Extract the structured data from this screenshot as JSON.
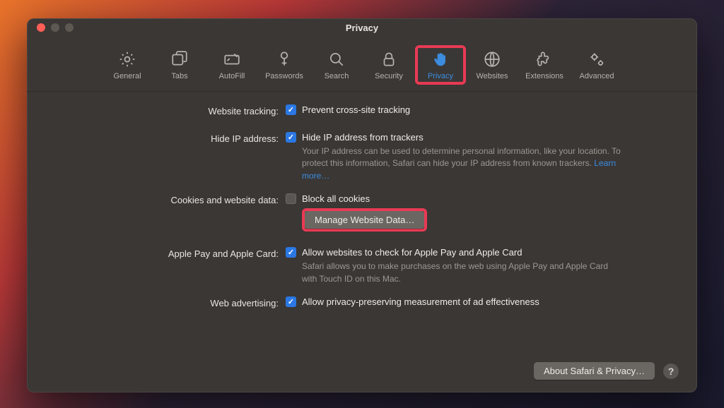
{
  "window": {
    "title": "Privacy"
  },
  "toolbar": {
    "items": [
      {
        "id": "general",
        "label": "General"
      },
      {
        "id": "tabs",
        "label": "Tabs"
      },
      {
        "id": "autofill",
        "label": "AutoFill"
      },
      {
        "id": "passwords",
        "label": "Passwords"
      },
      {
        "id": "search",
        "label": "Search"
      },
      {
        "id": "security",
        "label": "Security"
      },
      {
        "id": "privacy",
        "label": "Privacy",
        "active": true
      },
      {
        "id": "websites",
        "label": "Websites"
      },
      {
        "id": "extensions",
        "label": "Extensions"
      },
      {
        "id": "advanced",
        "label": "Advanced"
      }
    ]
  },
  "sections": {
    "website_tracking": {
      "label": "Website tracking:",
      "checkbox_label": "Prevent cross-site tracking",
      "checked": true
    },
    "hide_ip": {
      "label": "Hide IP address:",
      "checkbox_label": "Hide IP address from trackers",
      "checked": true,
      "desc": "Your IP address can be used to determine personal information, like your location. To protect this information, Safari can hide your IP address from known trackers. ",
      "learn_more": "Learn more…"
    },
    "cookies": {
      "label": "Cookies and website data:",
      "checkbox_label": "Block all cookies",
      "checked": false,
      "manage_button": "Manage Website Data…"
    },
    "apple_pay": {
      "label": "Apple Pay and Apple Card:",
      "checkbox_label": "Allow websites to check for Apple Pay and Apple Card",
      "checked": true,
      "desc": "Safari allows you to make purchases on the web using Apple Pay and Apple Card with Touch ID on this Mac."
    },
    "web_adv": {
      "label": "Web advertising:",
      "checkbox_label": "Allow privacy-preserving measurement of ad effectiveness",
      "checked": true
    }
  },
  "footer": {
    "about_button": "About Safari & Privacy…",
    "help": "?"
  }
}
